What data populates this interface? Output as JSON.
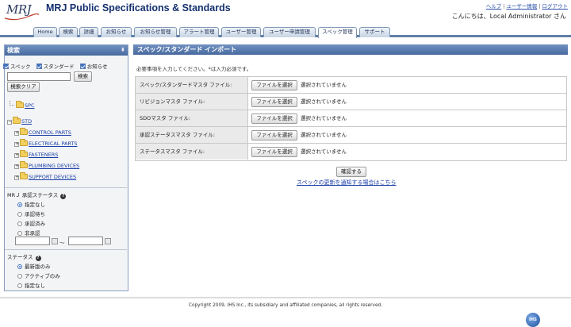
{
  "header": {
    "logo_text": "MRJ",
    "title": "MRJ Public Specifications & Standards",
    "links": [
      "ヘルプ",
      "ユーザー情報",
      "ログアウト"
    ],
    "link_separator": "|",
    "greeting": "こんにちは、Local Administrator さん"
  },
  "tabs": [
    {
      "label": "Home"
    },
    {
      "label": "検索"
    },
    {
      "label": "詳細"
    },
    {
      "label": "お知らせ"
    },
    {
      "label": "お知らせ管理"
    },
    {
      "label": "アラート管理"
    },
    {
      "label": "ユーザー管理"
    },
    {
      "label": "ユーザー申請管理"
    },
    {
      "label": "スペック管理",
      "active": true
    },
    {
      "label": "サポート"
    }
  ],
  "sidebar": {
    "title": "検索",
    "collapse_icon": "⇞",
    "checkboxes": [
      {
        "label": "スペック",
        "checked": true
      },
      {
        "label": "スタンダード",
        "checked": true
      },
      {
        "label": "お知らせ",
        "checked": true
      }
    ],
    "search_value": "",
    "search_button": "検索",
    "clear_button": "検索クリア",
    "tree": {
      "spc": "SPC",
      "std": "STD",
      "children": [
        "CONTROL PARTS",
        "ELECTRICAL PARTS",
        "FASTENERS",
        "PLUMBING DEVICES",
        "SUPPORT DEVICES"
      ]
    },
    "approval_status": {
      "label": "MRＪ 承認ステータス",
      "options": [
        "指定なし",
        "承認待ち",
        "承認済み",
        "非承認"
      ],
      "selected": 0,
      "date_from": "",
      "date_sep": "〜",
      "date_to": ""
    },
    "status": {
      "label": "ステータス",
      "options": [
        "最新版のみ",
        "アクティブのみ",
        "指定なし"
      ],
      "selected": 0
    }
  },
  "main": {
    "title": "スペック/スタンダード インポート",
    "required_note": "必要事項を入力してください。*は入力必須です。",
    "file_rows": [
      {
        "label": "スペック/スタンダードマスタ ファイル:",
        "button": "ファイルを選択",
        "status": "選択されていません"
      },
      {
        "label": "リビジョンマスタ ファイル:",
        "button": "ファイルを選択",
        "status": "選択されていません"
      },
      {
        "label": "SDOマスタ ファイル:",
        "button": "ファイルを選択",
        "status": "選択されていません"
      },
      {
        "label": "承認ステータスマスタ ファイル:",
        "button": "ファイルを選択",
        "status": "選択されていません"
      },
      {
        "label": "ステータスマスタ ファイル:",
        "button": "ファイルを選択",
        "status": "選択されていません"
      }
    ],
    "confirm_button": "確認する",
    "notify_link": "スペックの更新を通知する場合はこちら"
  },
  "footer": {
    "copyright": "Copyright 2009, IHS Inc., its subsidiary and affiliated companies, all rights reserved.",
    "ihs_logo": "IHS"
  }
}
